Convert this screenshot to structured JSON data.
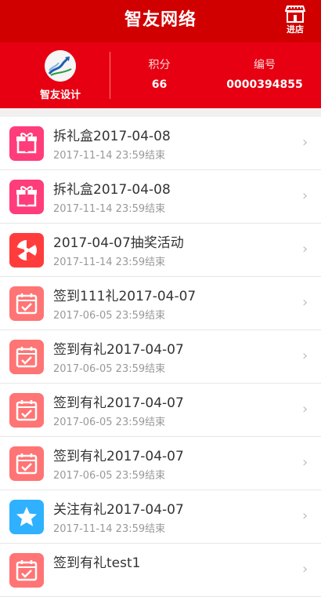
{
  "header": {
    "title": "智友网络",
    "store_label": "进店"
  },
  "profile": {
    "name": "智友设计",
    "points_label": "积分",
    "points_value": "66",
    "number_label": "编号",
    "number_value": "0000394855"
  },
  "activities": [
    {
      "title": "拆礼盒2017-04-08",
      "subtitle": "2017-11-14 23:59结束",
      "icon": "gift-icon",
      "color": "#ff3d7b"
    },
    {
      "title": "拆礼盒2017-04-08",
      "subtitle": "2017-11-14 23:59结束",
      "icon": "gift-icon",
      "color": "#ff3d7b"
    },
    {
      "title": "2017-04-07抽奖活动",
      "subtitle": "2017-11-14 23:59结束",
      "icon": "prize-wheel-icon",
      "color": "#ff3c3c"
    },
    {
      "title": "签到111礼2017-04-07",
      "subtitle": "2017-06-05 23:59结束",
      "icon": "calendar-check-icon",
      "color": "#ff7474"
    },
    {
      "title": "签到有礼2017-04-07",
      "subtitle": "2017-06-05 23:59结束",
      "icon": "calendar-check-icon",
      "color": "#ff7474"
    },
    {
      "title": "签到有礼2017-04-07",
      "subtitle": "2017-06-05 23:59结束",
      "icon": "calendar-check-icon",
      "color": "#ff7474"
    },
    {
      "title": "签到有礼2017-04-07",
      "subtitle": "2017-06-05 23:59结束",
      "icon": "calendar-check-icon",
      "color": "#ff7474"
    },
    {
      "title": "关注有礼2017-04-07",
      "subtitle": "2017-11-14 23:59结束",
      "icon": "star-icon",
      "color": "#2fb1ff"
    },
    {
      "title": "签到有礼test1",
      "subtitle": "",
      "icon": "calendar-check-icon",
      "color": "#ff7474"
    }
  ],
  "colors": {
    "header_bg": "#d10000",
    "profile_bg": "#e60012"
  }
}
